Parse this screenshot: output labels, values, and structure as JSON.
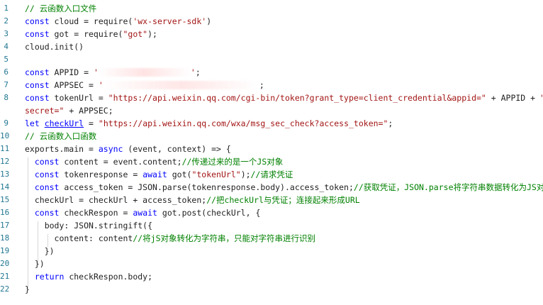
{
  "line_numbers": [
    "1",
    "2",
    "3",
    "4",
    "5",
    "6",
    "7",
    "8",
    "9",
    "10",
    "11",
    "12",
    "13",
    "14",
    "15",
    "16",
    "17",
    "18",
    "19",
    "20",
    "21",
    "22"
  ],
  "lines": [
    {
      "parts": [
        {
          "c": "cmt",
          "t": "// 云函数入口文件"
        }
      ]
    },
    {
      "parts": [
        {
          "c": "kw",
          "t": "const"
        },
        {
          "c": "plain",
          "t": " cloud = require("
        },
        {
          "c": "str",
          "t": "'wx-server-sdk'"
        },
        {
          "c": "plain",
          "t": ")"
        }
      ]
    },
    {
      "parts": [
        {
          "c": "kw",
          "t": "const"
        },
        {
          "c": "plain",
          "t": " got = require("
        },
        {
          "c": "str",
          "t": "\"got\""
        },
        {
          "c": "plain",
          "t": ");"
        }
      ]
    },
    {
      "parts": [
        {
          "c": "plain",
          "t": "cloud.init()"
        }
      ]
    },
    {
      "parts": []
    },
    {
      "parts": [
        {
          "c": "kw",
          "t": "const"
        },
        {
          "c": "plain",
          "t": " APPID = "
        },
        {
          "c": "str",
          "t": "'"
        },
        {
          "c": "redact",
          "t": ""
        },
        {
          "c": "str",
          "t": "'"
        },
        {
          "c": "plain",
          "t": ";"
        }
      ]
    },
    {
      "parts": [
        {
          "c": "kw",
          "t": "const"
        },
        {
          "c": "plain",
          "t": " APPSEC = "
        },
        {
          "c": "str",
          "t": "'"
        },
        {
          "c": "redact-short",
          "t": ""
        },
        {
          "c": "plain",
          "t": ";"
        }
      ]
    },
    {
      "parts": [
        {
          "c": "kw",
          "t": "const"
        },
        {
          "c": "plain",
          "t": " tokenUrl = "
        },
        {
          "c": "str",
          "t": "\"https://api.weixin.qq.com/cgi-bin/token?grant_type=client_credential&appid=\""
        },
        {
          "c": "plain",
          "t": " + APPID + "
        },
        {
          "c": "str",
          "t": "\"&"
        }
      ]
    },
    {
      "parts": [
        {
          "c": "str",
          "t": "secret=\""
        },
        {
          "c": "plain",
          "t": " + APPSEC;"
        }
      ]
    },
    {
      "parts": [
        {
          "c": "kw",
          "t": "let"
        },
        {
          "c": "plain",
          "t": " "
        },
        {
          "c": "link",
          "t": "checkUrl"
        },
        {
          "c": "plain",
          "t": " = "
        },
        {
          "c": "str",
          "t": "\"https://api.weixin.qq.com/wxa/msg_sec_check?access_token=\""
        },
        {
          "c": "plain",
          "t": ";"
        }
      ]
    },
    {
      "parts": [
        {
          "c": "cmt",
          "t": "// 云函数入口函数"
        }
      ]
    },
    {
      "parts": [
        {
          "c": "plain",
          "t": "exports.main = "
        },
        {
          "c": "kw",
          "t": "async"
        },
        {
          "c": "plain",
          "t": " (event, context) => {"
        }
      ]
    },
    {
      "parts": [
        {
          "c": "plain",
          "t": "  "
        },
        {
          "c": "kw",
          "t": "const"
        },
        {
          "c": "plain",
          "t": " content = event.content;"
        },
        {
          "c": "cmt",
          "t": "//传递过来的是一个JS对象"
        }
      ]
    },
    {
      "parts": [
        {
          "c": "plain",
          "t": "  "
        },
        {
          "c": "kw",
          "t": "const"
        },
        {
          "c": "plain",
          "t": " tokenresponse = "
        },
        {
          "c": "kw",
          "t": "await"
        },
        {
          "c": "plain",
          "t": " got("
        },
        {
          "c": "str",
          "t": "\"tokenUrl\""
        },
        {
          "c": "plain",
          "t": ");"
        },
        {
          "c": "cmt",
          "t": "//请求凭证"
        }
      ]
    },
    {
      "parts": [
        {
          "c": "plain",
          "t": "  "
        },
        {
          "c": "kw",
          "t": "const"
        },
        {
          "c": "plain",
          "t": " access_token = JSON.parse(tokenresponse.body).access_token;"
        },
        {
          "c": "cmt",
          "t": "//获取凭证，JSON.parse将字符串数据转化为JS对象"
        }
      ]
    },
    {
      "parts": [
        {
          "c": "plain",
          "t": "  checkUrl = checkUrl + access_token;"
        },
        {
          "c": "cmt",
          "t": "//把checkUrl与凭证；连接起来形成URL"
        }
      ]
    },
    {
      "parts": [
        {
          "c": "plain",
          "t": "  "
        },
        {
          "c": "kw",
          "t": "const"
        },
        {
          "c": "plain",
          "t": " checkRespon = "
        },
        {
          "c": "kw",
          "t": "await"
        },
        {
          "c": "plain",
          "t": " got.post(checkUrl, {"
        }
      ]
    },
    {
      "parts": [
        {
          "c": "plain",
          "t": "    body: JSON.stringift({"
        }
      ]
    },
    {
      "parts": [
        {
          "c": "plain",
          "t": "      content: content"
        },
        {
          "c": "cmt",
          "t": "//将jS对象转化为字符串，只能对字符串进行识别"
        }
      ]
    },
    {
      "parts": [
        {
          "c": "plain",
          "t": "    })"
        }
      ]
    },
    {
      "parts": [
        {
          "c": "plain",
          "t": "  })"
        }
      ]
    },
    {
      "parts": [
        {
          "c": "plain",
          "t": "  "
        },
        {
          "c": "kw",
          "t": "return"
        },
        {
          "c": "plain",
          "t": " checkRespon.body;"
        }
      ]
    },
    {
      "parts": [
        {
          "c": "plain",
          "t": "}"
        }
      ]
    }
  ],
  "colors": {
    "keyword": "#0000ff",
    "string": "#a31515",
    "comment": "#008000",
    "line_number": "#237893"
  }
}
